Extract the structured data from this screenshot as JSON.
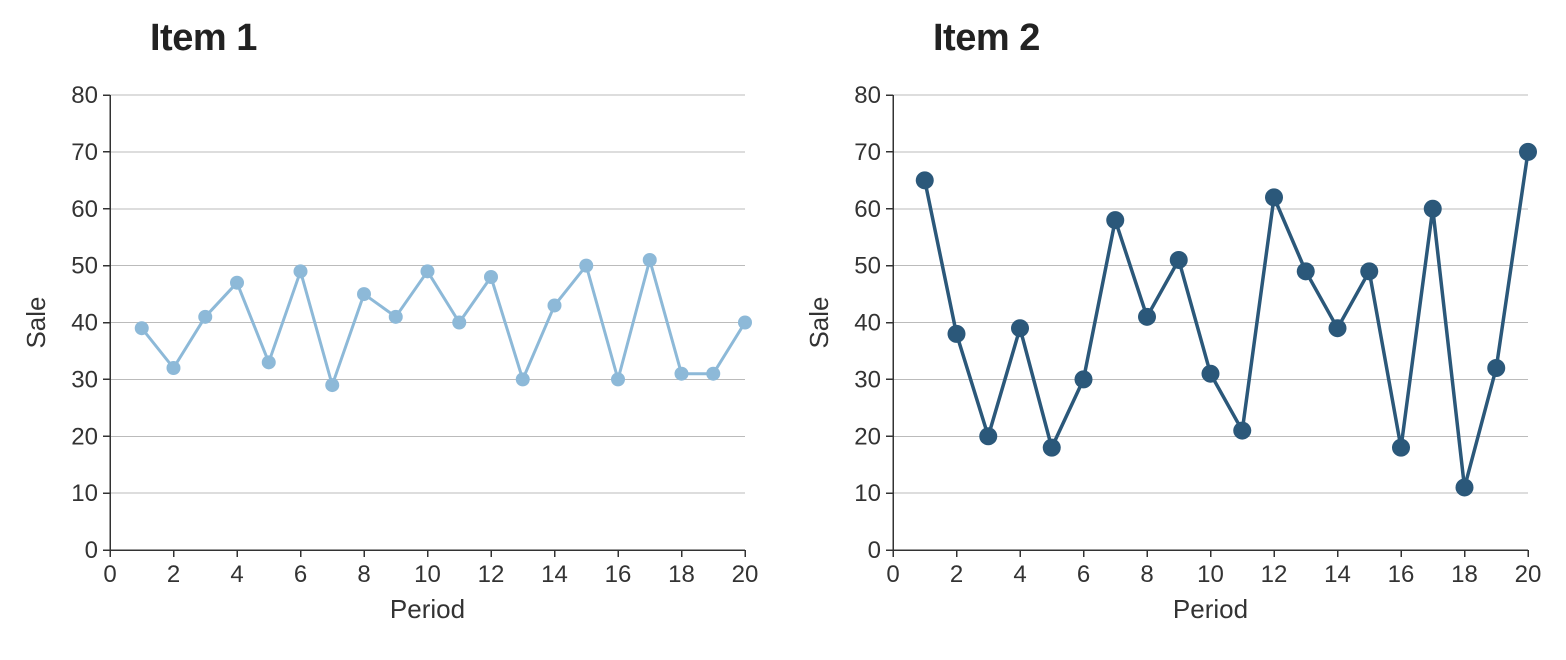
{
  "chart_data": [
    {
      "type": "line",
      "title": "Item 1",
      "xlabel": "Period",
      "ylabel": "Sale",
      "xlim": [
        0,
        20
      ],
      "ylim": [
        0,
        80
      ],
      "xticks": [
        0,
        2,
        4,
        6,
        8,
        10,
        12,
        14,
        16,
        18,
        20
      ],
      "yticks": [
        0,
        10,
        20,
        30,
        40,
        50,
        60,
        70,
        80
      ],
      "x": [
        1,
        2,
        3,
        4,
        5,
        6,
        7,
        8,
        9,
        10,
        11,
        12,
        13,
        14,
        15,
        16,
        17,
        18,
        19,
        20
      ],
      "values": [
        39,
        32,
        41,
        47,
        33,
        49,
        29,
        45,
        41,
        49,
        40,
        48,
        30,
        43,
        50,
        30,
        51,
        31,
        31,
        40
      ],
      "color": "#8db9d8",
      "point_radius": 7,
      "line_width": 3
    },
    {
      "type": "line",
      "title": "Item 2",
      "xlabel": "Period",
      "ylabel": "Sale",
      "xlim": [
        0,
        20
      ],
      "ylim": [
        0,
        80
      ],
      "xticks": [
        0,
        2,
        4,
        6,
        8,
        10,
        12,
        14,
        16,
        18,
        20
      ],
      "yticks": [
        0,
        10,
        20,
        30,
        40,
        50,
        60,
        70,
        80
      ],
      "x": [
        1,
        2,
        3,
        4,
        5,
        6,
        7,
        8,
        9,
        10,
        11,
        12,
        13,
        14,
        15,
        16,
        17,
        18,
        19,
        20
      ],
      "values": [
        65,
        38,
        20,
        39,
        18,
        30,
        58,
        41,
        51,
        31,
        21,
        62,
        49,
        39,
        49,
        18,
        60,
        11,
        32,
        70
      ],
      "color": "#2b587a",
      "point_radius": 9,
      "line_width": 3.5
    }
  ]
}
